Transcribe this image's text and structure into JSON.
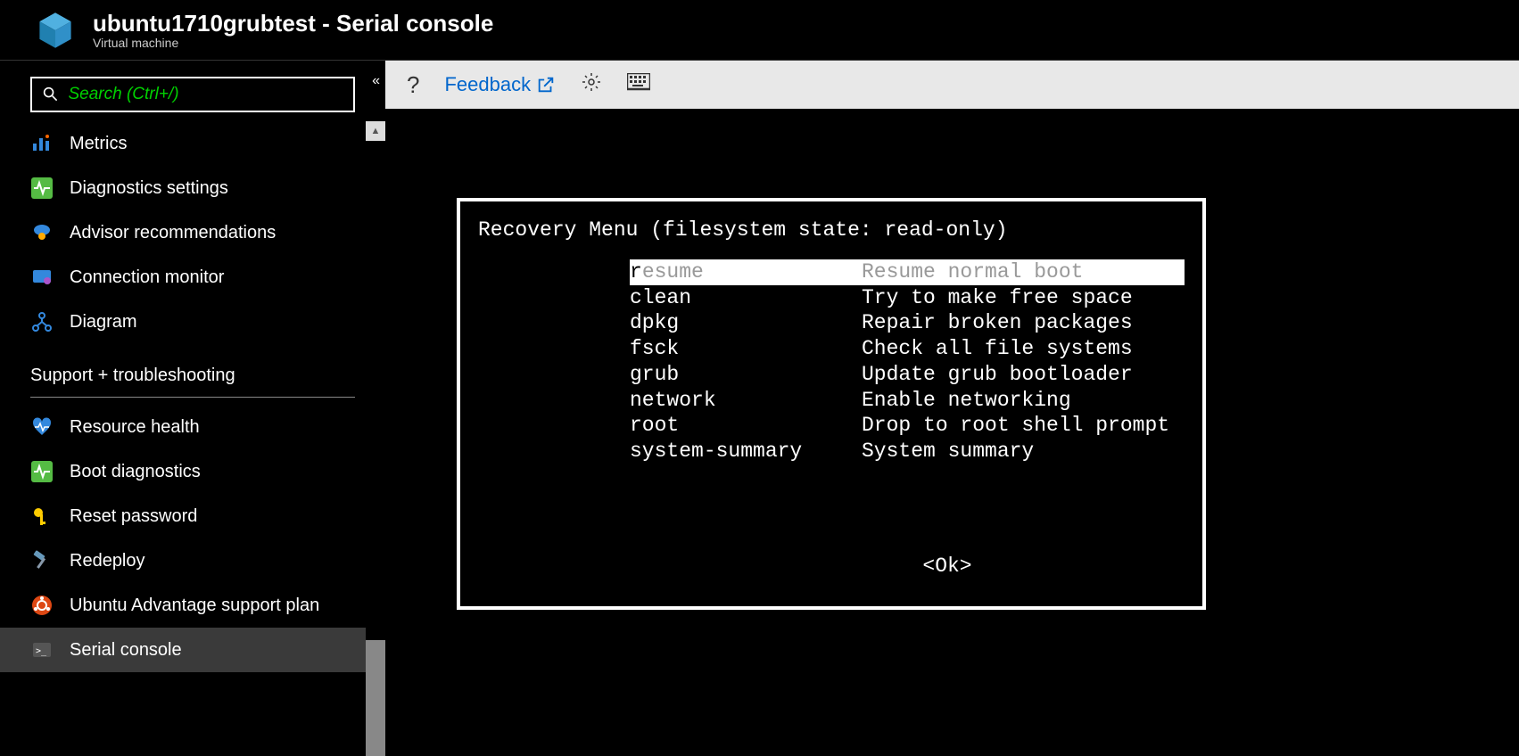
{
  "header": {
    "title": "ubuntu1710grubtest - Serial console",
    "subtitle": "Virtual machine"
  },
  "search": {
    "placeholder": "Search (Ctrl+/)"
  },
  "nav": {
    "items": [
      {
        "label": "Metrics"
      },
      {
        "label": "Diagnostics settings"
      },
      {
        "label": "Advisor recommendations"
      },
      {
        "label": "Connection monitor"
      },
      {
        "label": "Diagram"
      }
    ],
    "section": "Support + troubleshooting",
    "support_items": [
      {
        "label": "Resource health"
      },
      {
        "label": "Boot diagnostics"
      },
      {
        "label": "Reset password"
      },
      {
        "label": "Redeploy"
      },
      {
        "label": "Ubuntu Advantage support plan"
      },
      {
        "label": "Serial console"
      }
    ]
  },
  "toolbar": {
    "feedback": "Feedback"
  },
  "console": {
    "title": "Recovery Menu (filesystem state: read-only)",
    "rows": [
      {
        "cmd": "resume",
        "desc": "Resume normal boot",
        "selected": true
      },
      {
        "cmd": "clean",
        "desc": "Try to make free space"
      },
      {
        "cmd": "dpkg",
        "desc": "Repair broken packages"
      },
      {
        "cmd": "fsck",
        "desc": "Check all file systems"
      },
      {
        "cmd": "grub",
        "desc": "Update grub bootloader"
      },
      {
        "cmd": "network",
        "desc": "Enable networking"
      },
      {
        "cmd": "root",
        "desc": "Drop to root shell prompt"
      },
      {
        "cmd": "system-summary",
        "desc": "System summary"
      }
    ],
    "ok": "<Ok>"
  }
}
